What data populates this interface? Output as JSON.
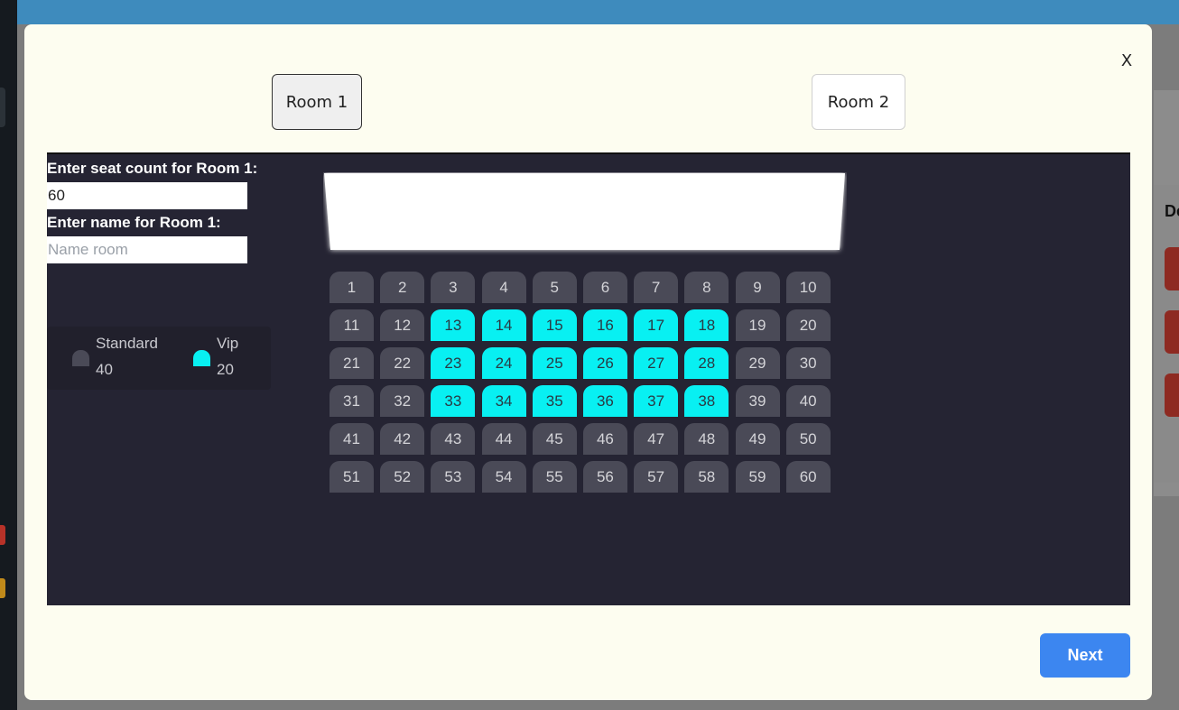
{
  "modal": {
    "close_label": "X",
    "tabs": [
      {
        "label": "Room 1",
        "active": true
      },
      {
        "label": "Room 2",
        "active": false
      }
    ],
    "seat_count_label": "Enter seat count for Room 1:",
    "seat_count_value": "60",
    "name_label": "Enter name for Room 1:",
    "name_placeholder": "Name room",
    "name_value": "",
    "legend": {
      "standard": {
        "name": "Standard",
        "count": "40",
        "color": "#4a4a57"
      },
      "vip": {
        "name": "Vip",
        "count": "20",
        "color": "#08f0f2"
      }
    },
    "seats": {
      "total": 60,
      "columns": 10,
      "vip": [
        13,
        14,
        15,
        16,
        17,
        18,
        23,
        24,
        25,
        26,
        27,
        28,
        33,
        34,
        35,
        36,
        37,
        38
      ]
    },
    "next_label": "Next"
  },
  "background": {
    "header_fragment": "De"
  },
  "colors": {
    "modal_bg": "#fdfdf0",
    "content_bg": "#252433",
    "accent_button": "#3c86f0",
    "vip_seat": "#08f0f2",
    "standard_seat": "#4a4a57"
  }
}
